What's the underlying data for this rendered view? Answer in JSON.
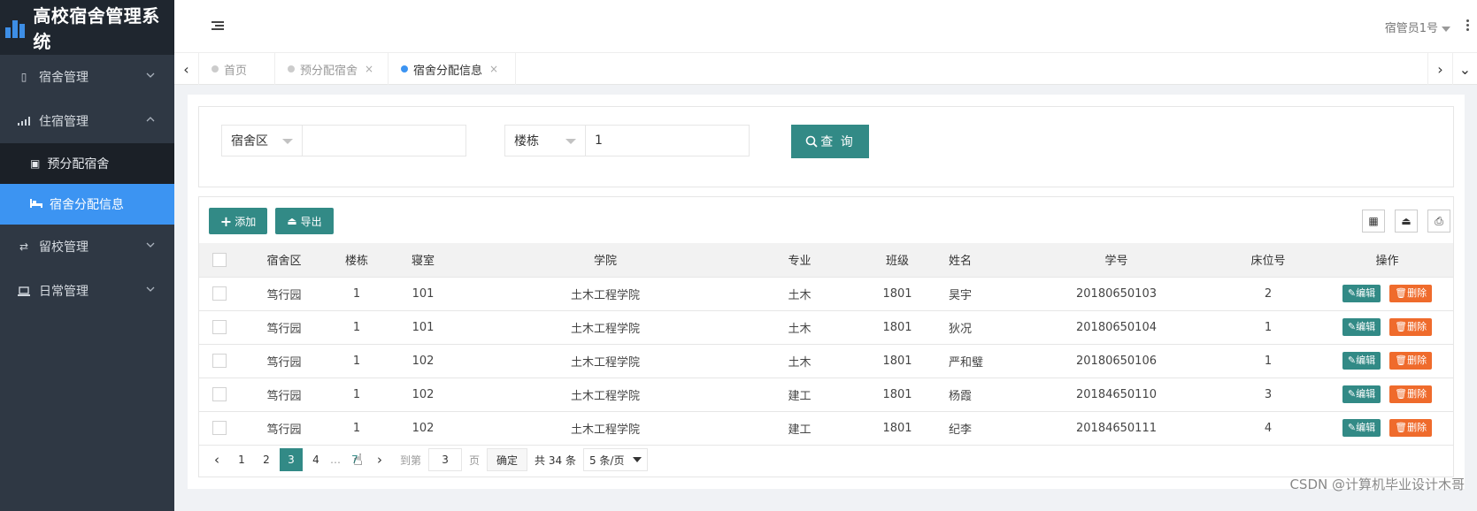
{
  "app": {
    "title": "高校宿舍管理系统"
  },
  "sidebar": {
    "items": [
      {
        "label": "宿舍管理",
        "icon": "building-icon"
      },
      {
        "label": "住宿管理",
        "icon": "signal-bars-icon"
      },
      {
        "label": "留校管理",
        "icon": "exchange-icon"
      },
      {
        "label": "日常管理",
        "icon": "laptop-icon"
      }
    ],
    "sub": [
      {
        "label": "预分配宿舍",
        "icon": "id-card-icon"
      },
      {
        "label": "宿舍分配信息",
        "icon": "bed-icon"
      }
    ]
  },
  "header": {
    "user": "宿管员1号"
  },
  "tabs": [
    {
      "label": "首页"
    },
    {
      "label": "预分配宿舍",
      "close": "×"
    },
    {
      "label": "宿舍分配信息",
      "close": "×"
    }
  ],
  "search": {
    "area_label": "宿舍区",
    "area_value": "",
    "building_label": "楼栋",
    "building_value": "1",
    "query_button": "查 询"
  },
  "toolbar": {
    "add": "添加",
    "export": "导出"
  },
  "table": {
    "headers": [
      "宿舍区",
      "楼栋",
      "寝室",
      "学院",
      "专业",
      "班级",
      "姓名",
      "学号",
      "床位号",
      "操作"
    ],
    "rows": [
      [
        "笃行园",
        "1",
        "101",
        "土木工程学院",
        "土木",
        "1801",
        "昊宇",
        "20180650103",
        "2"
      ],
      [
        "笃行园",
        "1",
        "101",
        "土木工程学院",
        "土木",
        "1801",
        "狄况",
        "20180650104",
        "1"
      ],
      [
        "笃行园",
        "1",
        "102",
        "土木工程学院",
        "土木",
        "1801",
        "严和璧",
        "20180650106",
        "1"
      ],
      [
        "笃行园",
        "1",
        "102",
        "土木工程学院",
        "建工",
        "1801",
        "杨霞",
        "20184650110",
        "3"
      ],
      [
        "笃行园",
        "1",
        "102",
        "土木工程学院",
        "建工",
        "1801",
        "纪李",
        "20184650111",
        "4"
      ]
    ],
    "edit_label": "编辑",
    "delete_label": "删除"
  },
  "pagination": {
    "prev": "‹",
    "pages": [
      "1",
      "2",
      "3",
      "4"
    ],
    "current": "3",
    "ellipsis": "…",
    "last": "7",
    "next": "›",
    "goto_prefix": "到第",
    "goto_value": "3",
    "goto_suffix": "页",
    "confirm": "确定",
    "total": "共 34 条",
    "page_size": "5 条/页"
  },
  "watermark": "CSDN @计算机毕业设计木哥",
  "colors": {
    "sidebar_bg": "#2f3844",
    "active_menu": "#3c94f2",
    "primary": "#328a86",
    "danger": "#ef6b2c"
  }
}
